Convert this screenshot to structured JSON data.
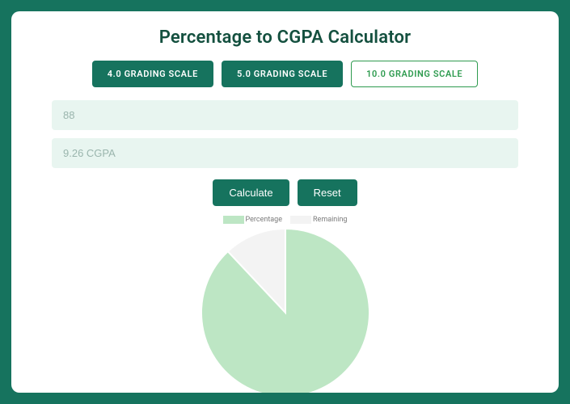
{
  "title": "Percentage to CGPA Calculator",
  "tabs": {
    "t0": "4.0 GRADING SCALE",
    "t1": "5.0 GRADING SCALE",
    "t2": "10.0 GRADING SCALE"
  },
  "inputs": {
    "percentage_value": "88",
    "cgpa_value": "9.26 CGPA"
  },
  "buttons": {
    "calculate": "Calculate",
    "reset": "Reset"
  },
  "legend": {
    "percentage": "Percentage",
    "remaining": "Remaining"
  },
  "colors": {
    "brand": "#16735e",
    "accent": "#2e9b4f",
    "slice_pct": "#bde6c4",
    "slice_rem": "#f3f3f3",
    "slice_stroke": "#ffffff"
  },
  "chart_data": {
    "type": "pie",
    "title": "",
    "series": [
      {
        "name": "Percentage",
        "value": 88
      },
      {
        "name": "Remaining",
        "value": 12
      }
    ]
  }
}
